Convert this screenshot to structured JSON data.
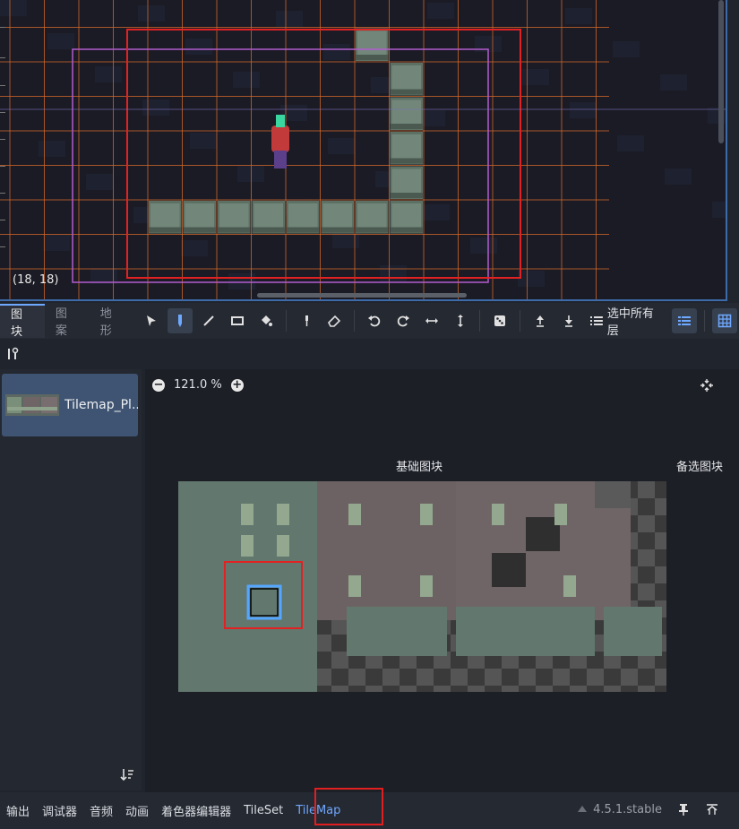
{
  "viewport": {
    "cursor_coordinate": "(18, 18)",
    "colors": {
      "grid": "#d86a2a",
      "camera_rect": "#e22222",
      "limits_rect": "#b25ccf",
      "background": "#1b1b25"
    }
  },
  "toolbar": {
    "tabs": [
      {
        "label": "图块",
        "active": true
      },
      {
        "label": "图案",
        "active": false
      },
      {
        "label": "地形",
        "active": false
      }
    ],
    "tools": [
      "select-icon",
      "paint-icon",
      "line-icon",
      "rect-icon",
      "bucket-icon",
      "picker-icon",
      "eraser-icon",
      "rotate-left-icon",
      "rotate-right-icon",
      "flip-h-icon",
      "flip-v-icon",
      "random-icon",
      "layer-up-icon",
      "layer-down-icon"
    ],
    "layer_selector_label": "选中所有层"
  },
  "source_panel": {
    "items": [
      {
        "label": "Tilemap_Pl..."
      }
    ]
  },
  "atlas": {
    "zoom": "121.0 %",
    "base_tiles_label": "基础图块",
    "alt_tiles_label": "备选图块"
  },
  "bottombar": {
    "tabs": [
      {
        "label": "输出",
        "selected": false
      },
      {
        "label": "调试器",
        "selected": false
      },
      {
        "label": "音频",
        "selected": false
      },
      {
        "label": "动画",
        "selected": false
      },
      {
        "label": "着色器编辑器",
        "selected": false
      },
      {
        "label": "TileSet",
        "selected": false
      },
      {
        "label": "TileMap",
        "selected": true
      }
    ],
    "version": "4.5.1.stable"
  }
}
